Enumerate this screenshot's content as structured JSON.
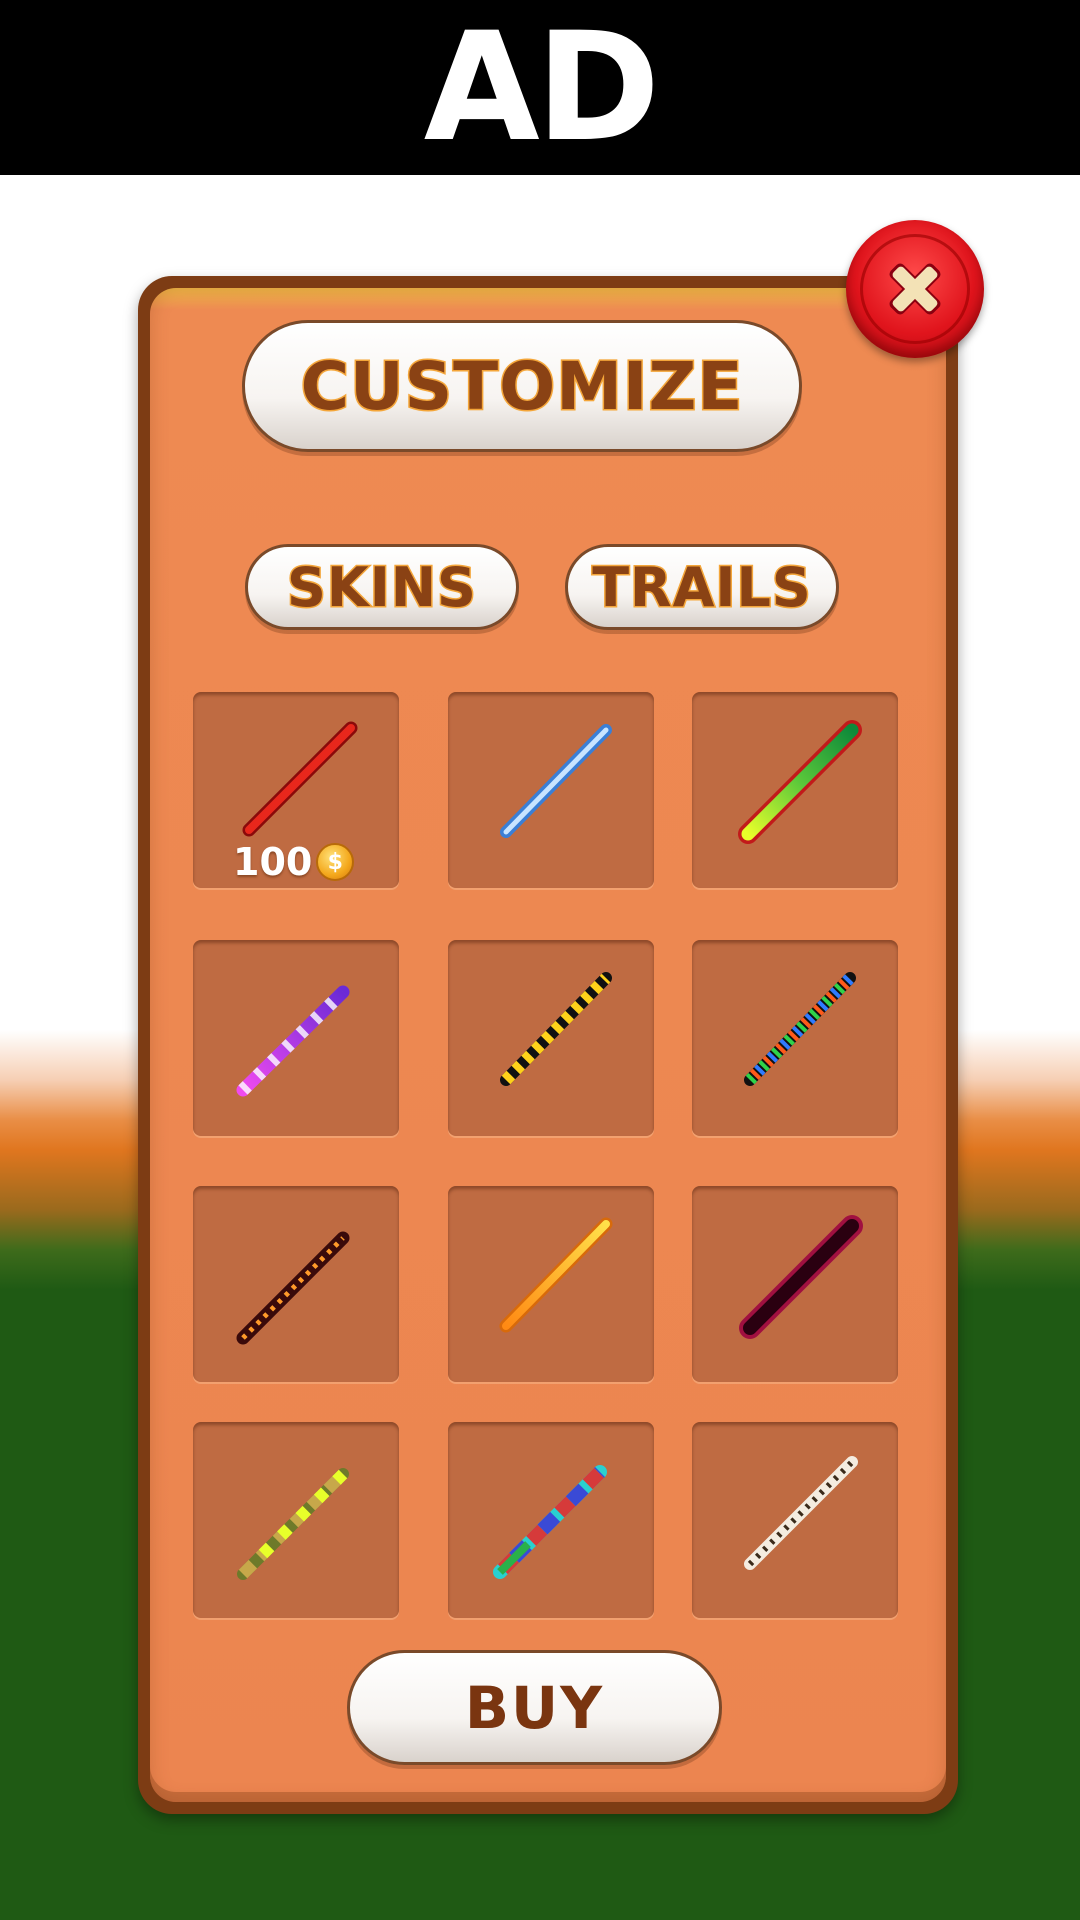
{
  "ad": {
    "label": "AD"
  },
  "panel": {
    "title": "CUSTOMIZE",
    "close_icon": "close-x-icon",
    "tabs": [
      {
        "label": "SKINS"
      },
      {
        "label": "TRAILS"
      }
    ],
    "buy_label": "BUY",
    "items": [
      {
        "name": "red-stick",
        "price": "100",
        "currency_icon": "coin-icon",
        "colors": [
          "#e8271c",
          "#9a0a0a"
        ]
      },
      {
        "name": "light-blue-stick",
        "colors": [
          "#b8dcff",
          "#3a7fd6"
        ]
      },
      {
        "name": "lime-green-stick",
        "colors": [
          "#e8ff2a",
          "#1a9a3a",
          "#c21a1a"
        ]
      },
      {
        "name": "purple-twist-stick",
        "colors": [
          "#e545e5",
          "#7a2fd6",
          "#ffffff"
        ]
      },
      {
        "name": "black-yellow-stripe-stick",
        "colors": [
          "#111111",
          "#ffd21a"
        ]
      },
      {
        "name": "rainbow-stripe-stick",
        "colors": [
          "#111111",
          "#2fd34a",
          "#2f7bff",
          "#ff5a1a"
        ]
      },
      {
        "name": "lava-dots-stick",
        "colors": [
          "#3a0a0a",
          "#ff9a2a"
        ]
      },
      {
        "name": "orange-gradient-stick",
        "colors": [
          "#ffd84a",
          "#ff7a14"
        ]
      },
      {
        "name": "dark-maroon-stick",
        "colors": [
          "#2a0010",
          "#a01040"
        ]
      },
      {
        "name": "camo-yellow-stick",
        "colors": [
          "#e8ff2a",
          "#c7a84a",
          "#6e7a2a"
        ]
      },
      {
        "name": "mosaic-stick",
        "colors": [
          "#2ad0d0",
          "#3a4ad6",
          "#d63a3a",
          "#2ab04a"
        ]
      },
      {
        "name": "leopard-stick",
        "colors": [
          "#f4ece0",
          "#3a2a1a"
        ]
      }
    ]
  }
}
